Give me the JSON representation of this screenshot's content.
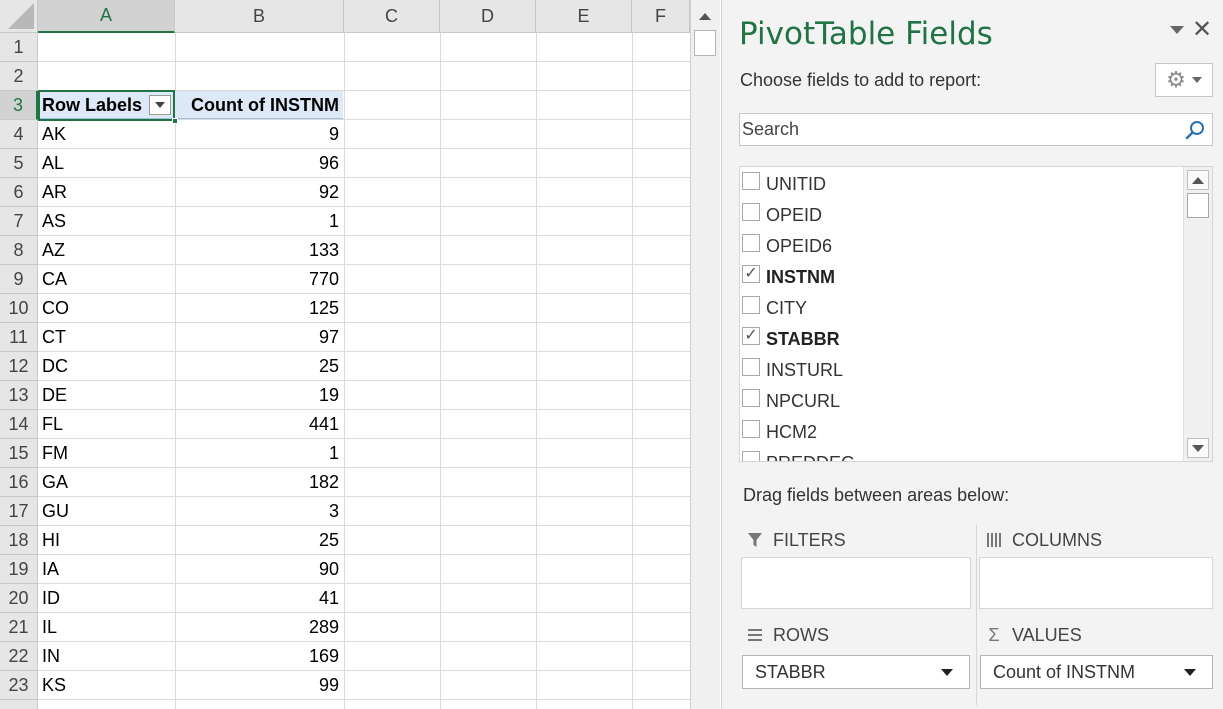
{
  "sheet": {
    "columns": [
      "A",
      "B",
      "C",
      "D",
      "E",
      "F"
    ],
    "selected_column": "A",
    "selected_row": "3",
    "rows": [
      {
        "num": "1",
        "a": "",
        "b": ""
      },
      {
        "num": "2",
        "a": "",
        "b": ""
      },
      {
        "num": "3",
        "a": "Row Labels",
        "b": "Count of INSTNM"
      },
      {
        "num": "4",
        "a": "AK",
        "b": "9"
      },
      {
        "num": "5",
        "a": "AL",
        "b": "96"
      },
      {
        "num": "6",
        "a": "AR",
        "b": "92"
      },
      {
        "num": "7",
        "a": "AS",
        "b": "1"
      },
      {
        "num": "8",
        "a": "AZ",
        "b": "133"
      },
      {
        "num": "9",
        "a": "CA",
        "b": "770"
      },
      {
        "num": "10",
        "a": "CO",
        "b": "125"
      },
      {
        "num": "11",
        "a": "CT",
        "b": "97"
      },
      {
        "num": "12",
        "a": "DC",
        "b": "25"
      },
      {
        "num": "13",
        "a": "DE",
        "b": "19"
      },
      {
        "num": "14",
        "a": "FL",
        "b": "441"
      },
      {
        "num": "15",
        "a": "FM",
        "b": "1"
      },
      {
        "num": "16",
        "a": "GA",
        "b": "182"
      },
      {
        "num": "17",
        "a": "GU",
        "b": "3"
      },
      {
        "num": "18",
        "a": "HI",
        "b": "25"
      },
      {
        "num": "19",
        "a": "IA",
        "b": "90"
      },
      {
        "num": "20",
        "a": "ID",
        "b": "41"
      },
      {
        "num": "21",
        "a": "IL",
        "b": "289"
      },
      {
        "num": "22",
        "a": "IN",
        "b": "169"
      },
      {
        "num": "23",
        "a": "KS",
        "b": "99"
      }
    ]
  },
  "pane": {
    "title": "PivotTable Fields",
    "choose_label": "Choose fields to add to report:",
    "search_placeholder": "Search",
    "fields": [
      {
        "name": "UNITID",
        "checked": false
      },
      {
        "name": "OPEID",
        "checked": false
      },
      {
        "name": "OPEID6",
        "checked": false
      },
      {
        "name": "INSTNM",
        "checked": true
      },
      {
        "name": "CITY",
        "checked": false
      },
      {
        "name": "STABBR",
        "checked": true
      },
      {
        "name": "INSTURL",
        "checked": false
      },
      {
        "name": "NPCURL",
        "checked": false
      },
      {
        "name": "HCM2",
        "checked": false
      },
      {
        "name": "PREDDEG",
        "checked": false
      }
    ],
    "drag_label": "Drag fields between areas below:",
    "areas": {
      "filters": {
        "label": "FILTERS",
        "items": []
      },
      "columns": {
        "label": "COLUMNS",
        "items": []
      },
      "rows": {
        "label": "ROWS",
        "items": [
          "STABBR"
        ]
      },
      "values": {
        "label": "VALUES",
        "items": [
          "Count of INSTNM"
        ]
      }
    }
  },
  "colors": {
    "accent": "#217346",
    "pivot_header_fill": "#dde9f6"
  }
}
